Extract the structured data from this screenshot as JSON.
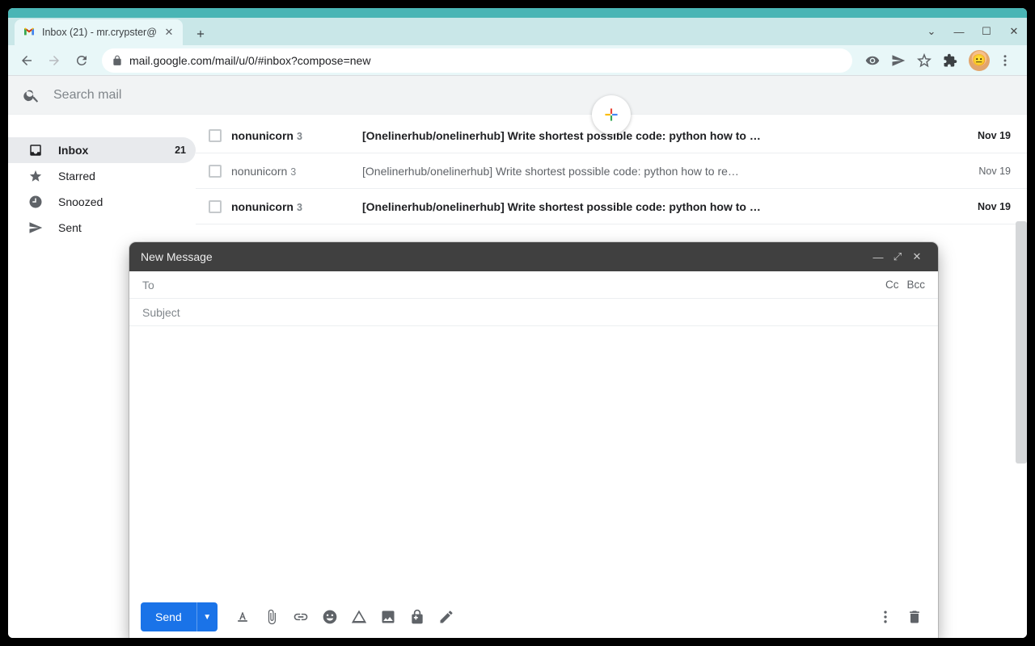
{
  "browser": {
    "tab_title": "Inbox (21) - mr.crypster@",
    "url": "mail.google.com/mail/u/0/#inbox?compose=new"
  },
  "search": {
    "placeholder": "Search mail"
  },
  "sidebar": {
    "items": [
      {
        "label": "Inbox",
        "count": "21",
        "active": true
      },
      {
        "label": "Starred"
      },
      {
        "label": "Snoozed"
      },
      {
        "label": "Sent"
      }
    ]
  },
  "emails": [
    {
      "from": "nonunicorn",
      "n": "3",
      "subject": "[Onelinerhub/onelinerhub] Write shortest possible code: python how to …",
      "date": "Nov 19",
      "unread": true
    },
    {
      "from": "nonunicorn",
      "n": "3",
      "subject": "[Onelinerhub/onelinerhub] Write shortest possible code: python how to re…",
      "date": "Nov 19",
      "unread": false
    },
    {
      "from": "nonunicorn",
      "n": "3",
      "subject": "[Onelinerhub/onelinerhub] Write shortest possible code: python how to …",
      "date": "Nov 19",
      "unread": true
    }
  ],
  "compose": {
    "title": "New Message",
    "to_label": "To",
    "cc_label": "Cc",
    "bcc_label": "Bcc",
    "subject_placeholder": "Subject",
    "send_label": "Send"
  }
}
